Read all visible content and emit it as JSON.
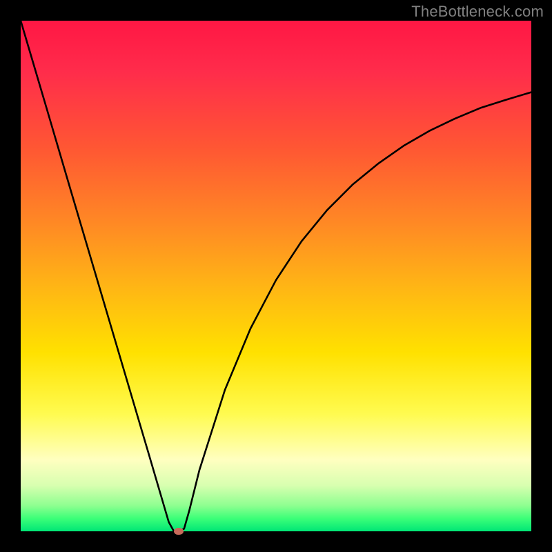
{
  "watermark": "TheBottleneck.com",
  "colors": {
    "frame": "#000000",
    "curve": "#000000",
    "dot": "#c76a5a",
    "gradient_top": "#ff1744",
    "gradient_bottom": "#00e676"
  },
  "chart_data": {
    "type": "line",
    "title": "",
    "xlabel": "",
    "ylabel": "",
    "xlim": [
      0,
      100
    ],
    "ylim": [
      0,
      100
    ],
    "series": [
      {
        "name": "bottleneck-curve",
        "x": [
          0,
          5,
          10,
          15,
          20,
          25,
          27,
          29,
          30,
          31,
          32,
          33,
          35,
          40,
          45,
          50,
          55,
          60,
          65,
          70,
          75,
          80,
          85,
          90,
          95,
          100
        ],
        "values": [
          100,
          83.1,
          66.1,
          49.2,
          32.3,
          15.4,
          8.6,
          1.8,
          0,
          0,
          0.5,
          4,
          12,
          27.7,
          39.7,
          49.2,
          56.8,
          62.9,
          67.9,
          72,
          75.5,
          78.4,
          80.8,
          82.9,
          84.5,
          86
        ]
      }
    ],
    "marker": {
      "name": "min-point",
      "x": 31,
      "y": 0
    }
  }
}
